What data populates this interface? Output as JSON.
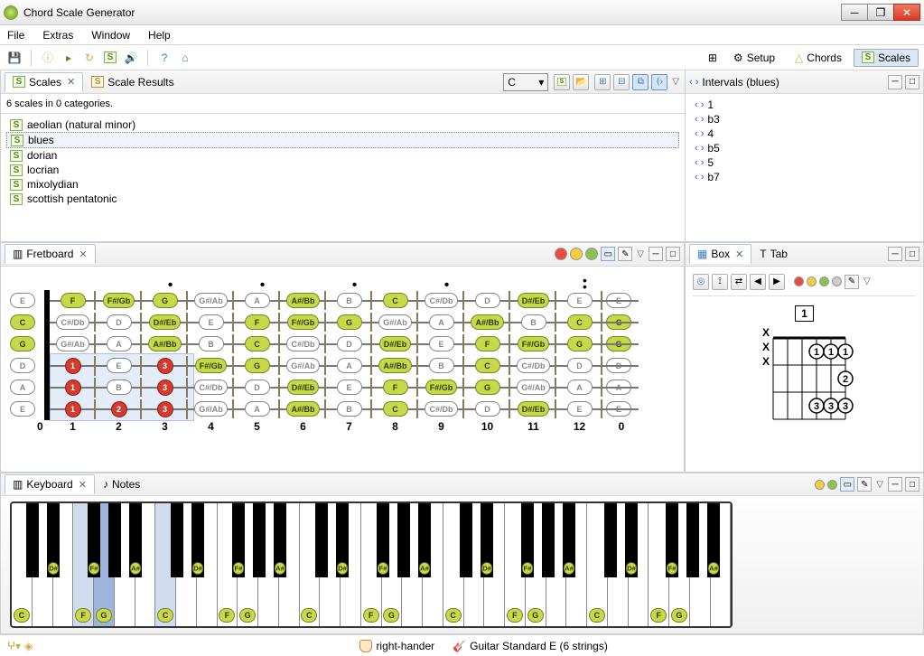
{
  "app": {
    "title": "Chord Scale Generator"
  },
  "menu": [
    "File",
    "Extras",
    "Window",
    "Help"
  ],
  "perspectives": {
    "setup": "Setup",
    "chords": "Chords",
    "scales": "Scales"
  },
  "scalesView": {
    "tab1": "Scales",
    "tab2": "Scale Results",
    "summary": "6 scales in 0 categories.",
    "items": [
      {
        "label": "aeolian (natural minor)",
        "selected": false
      },
      {
        "label": "blues",
        "selected": true
      },
      {
        "label": "dorian",
        "selected": false
      },
      {
        "label": "locrian",
        "selected": false
      },
      {
        "label": "mixolydian",
        "selected": false
      },
      {
        "label": "scottish pentatonic",
        "selected": false
      }
    ],
    "rootSelector": "C"
  },
  "intervalsView": {
    "title": "Intervals (blues)",
    "items": [
      "1",
      "b3",
      "4",
      "b5",
      "5",
      "b7"
    ]
  },
  "fretboardView": {
    "tab": "Fretboard",
    "fretNumbers": [
      "0",
      "1",
      "2",
      "3",
      "4",
      "5",
      "6",
      "7",
      "8",
      "9",
      "10",
      "11",
      "12",
      "0"
    ],
    "markerFrets": [
      3,
      5,
      7,
      9,
      12
    ],
    "doubleDotFrets": [
      12
    ],
    "strings": [
      {
        "open": "E",
        "openIn": false,
        "cells": [
          {
            "n": "F",
            "in": true
          },
          {
            "n": "F#/Gb",
            "in": true
          },
          {
            "n": "G",
            "in": true
          },
          {
            "n": "G#/Ab",
            "in": false
          },
          {
            "n": "A",
            "in": false
          },
          {
            "n": "A#/Bb",
            "in": true
          },
          {
            "n": "B",
            "in": false
          },
          {
            "n": "C",
            "in": true
          },
          {
            "n": "C#/Db",
            "in": false
          },
          {
            "n": "D",
            "in": false
          },
          {
            "n": "D#/Eb",
            "in": true
          },
          {
            "n": "E",
            "in": false
          }
        ]
      },
      {
        "open": "C",
        "openIn": true,
        "cells": [
          {
            "n": "C#/Db",
            "in": false
          },
          {
            "n": "D",
            "in": false
          },
          {
            "n": "D#/Eb",
            "in": true
          },
          {
            "n": "E",
            "in": false
          },
          {
            "n": "F",
            "in": true
          },
          {
            "n": "F#/Gb",
            "in": true
          },
          {
            "n": "G",
            "in": true
          },
          {
            "n": "G#/Ab",
            "in": false
          },
          {
            "n": "A",
            "in": false
          },
          {
            "n": "A#/Bb",
            "in": true
          },
          {
            "n": "B",
            "in": false
          },
          {
            "n": "C",
            "in": true
          }
        ]
      },
      {
        "open": "G",
        "openIn": true,
        "cells": [
          {
            "n": "G#/Ab",
            "in": false
          },
          {
            "n": "A",
            "in": false
          },
          {
            "n": "A#/Bb",
            "in": true
          },
          {
            "n": "B",
            "in": false
          },
          {
            "n": "C",
            "in": true
          },
          {
            "n": "C#/Db",
            "in": false
          },
          {
            "n": "D",
            "in": false
          },
          {
            "n": "D#/Eb",
            "in": true
          },
          {
            "n": "E",
            "in": false
          },
          {
            "n": "F",
            "in": true
          },
          {
            "n": "F#/Gb",
            "in": true
          },
          {
            "n": "G",
            "in": true
          }
        ]
      },
      {
        "open": "D",
        "openIn": false,
        "cells": [
          {
            "n": "",
            "in": false,
            "root": 1
          },
          {
            "n": "E",
            "in": false
          },
          {
            "n": "",
            "in": false,
            "root": 3
          },
          {
            "n": "F#/Gb",
            "in": true
          },
          {
            "n": "G",
            "in": true
          },
          {
            "n": "G#/Ab",
            "in": false
          },
          {
            "n": "A",
            "in": false
          },
          {
            "n": "A#/Bb",
            "in": true
          },
          {
            "n": "B",
            "in": false
          },
          {
            "n": "C",
            "in": true
          },
          {
            "n": "C#/Db",
            "in": false
          },
          {
            "n": "D",
            "in": false
          }
        ]
      },
      {
        "open": "A",
        "openIn": false,
        "cells": [
          {
            "n": "",
            "in": false,
            "root": 1
          },
          {
            "n": "B",
            "in": false
          },
          {
            "n": "",
            "in": false,
            "root": 3
          },
          {
            "n": "C#/Db",
            "in": false
          },
          {
            "n": "D",
            "in": false
          },
          {
            "n": "D#/Eb",
            "in": true
          },
          {
            "n": "E",
            "in": false
          },
          {
            "n": "F",
            "in": true
          },
          {
            "n": "F#/Gb",
            "in": true
          },
          {
            "n": "G",
            "in": true
          },
          {
            "n": "G#/Ab",
            "in": false
          },
          {
            "n": "A",
            "in": false
          }
        ]
      },
      {
        "open": "E",
        "openIn": false,
        "cells": [
          {
            "n": "",
            "in": false,
            "root": 1
          },
          {
            "n": "",
            "in": false,
            "root": 2
          },
          {
            "n": "",
            "in": false,
            "root": 3
          },
          {
            "n": "G#/Ab",
            "in": false
          },
          {
            "n": "A",
            "in": false
          },
          {
            "n": "A#/Bb",
            "in": true
          },
          {
            "n": "B",
            "in": false
          },
          {
            "n": "C",
            "in": true
          },
          {
            "n": "C#/Db",
            "in": false
          },
          {
            "n": "D",
            "in": false
          },
          {
            "n": "D#/Eb",
            "in": true
          },
          {
            "n": "E",
            "in": false
          }
        ]
      }
    ]
  },
  "boxView": {
    "tab1": "Box",
    "tab2": "Tab",
    "position": "1",
    "muted": [
      true,
      true,
      true,
      false,
      false,
      false
    ],
    "fingers": [
      {
        "string": 4,
        "fret": 1,
        "n": "1"
      },
      {
        "string": 4,
        "fret": 3,
        "n": "3"
      },
      {
        "string": 5,
        "fret": 1,
        "n": "1"
      },
      {
        "string": 5,
        "fret": 3,
        "n": "3"
      },
      {
        "string": 6,
        "fret": 1,
        "n": "1"
      },
      {
        "string": 6,
        "fret": 2,
        "n": "2"
      },
      {
        "string": 6,
        "fret": 3,
        "n": "3"
      }
    ]
  },
  "keyboardView": {
    "tab1": "Keyboard",
    "tab2": "Notes",
    "whiteKeys": [
      {
        "n": "C",
        "lbl": true
      },
      {
        "n": "D"
      },
      {
        "n": "E"
      },
      {
        "n": "F",
        "lbl": true,
        "hl": 2
      },
      {
        "n": "G",
        "lbl": true,
        "hl": 1
      },
      {
        "n": "A"
      },
      {
        "n": "B"
      },
      {
        "n": "C",
        "lbl": true,
        "hl": 2
      },
      {
        "n": "D"
      },
      {
        "n": "E"
      },
      {
        "n": "F",
        "lbl": true
      },
      {
        "n": "G",
        "lbl": true
      },
      {
        "n": "A"
      },
      {
        "n": "B"
      },
      {
        "n": "C",
        "lbl": true
      },
      {
        "n": "D"
      },
      {
        "n": "E"
      },
      {
        "n": "F",
        "lbl": true
      },
      {
        "n": "G",
        "lbl": true
      },
      {
        "n": "A"
      },
      {
        "n": "B"
      },
      {
        "n": "C",
        "lbl": true
      },
      {
        "n": "D"
      },
      {
        "n": "E"
      },
      {
        "n": "F",
        "lbl": true
      },
      {
        "n": "G",
        "lbl": true
      },
      {
        "n": "A"
      },
      {
        "n": "B"
      },
      {
        "n": "C",
        "lbl": true
      },
      {
        "n": "D"
      },
      {
        "n": "E"
      },
      {
        "n": "F",
        "lbl": true
      },
      {
        "n": "G",
        "lbl": true
      },
      {
        "n": "A"
      },
      {
        "n": "B"
      }
    ],
    "blackPattern": [
      1,
      1,
      0,
      1,
      1,
      1,
      0
    ],
    "blackLabels": {
      "1": "D#",
      "3": "F#",
      "5": "A#"
    }
  },
  "status": {
    "hand": "right-hander",
    "tuning": "Guitar Standard E (6 strings)"
  }
}
